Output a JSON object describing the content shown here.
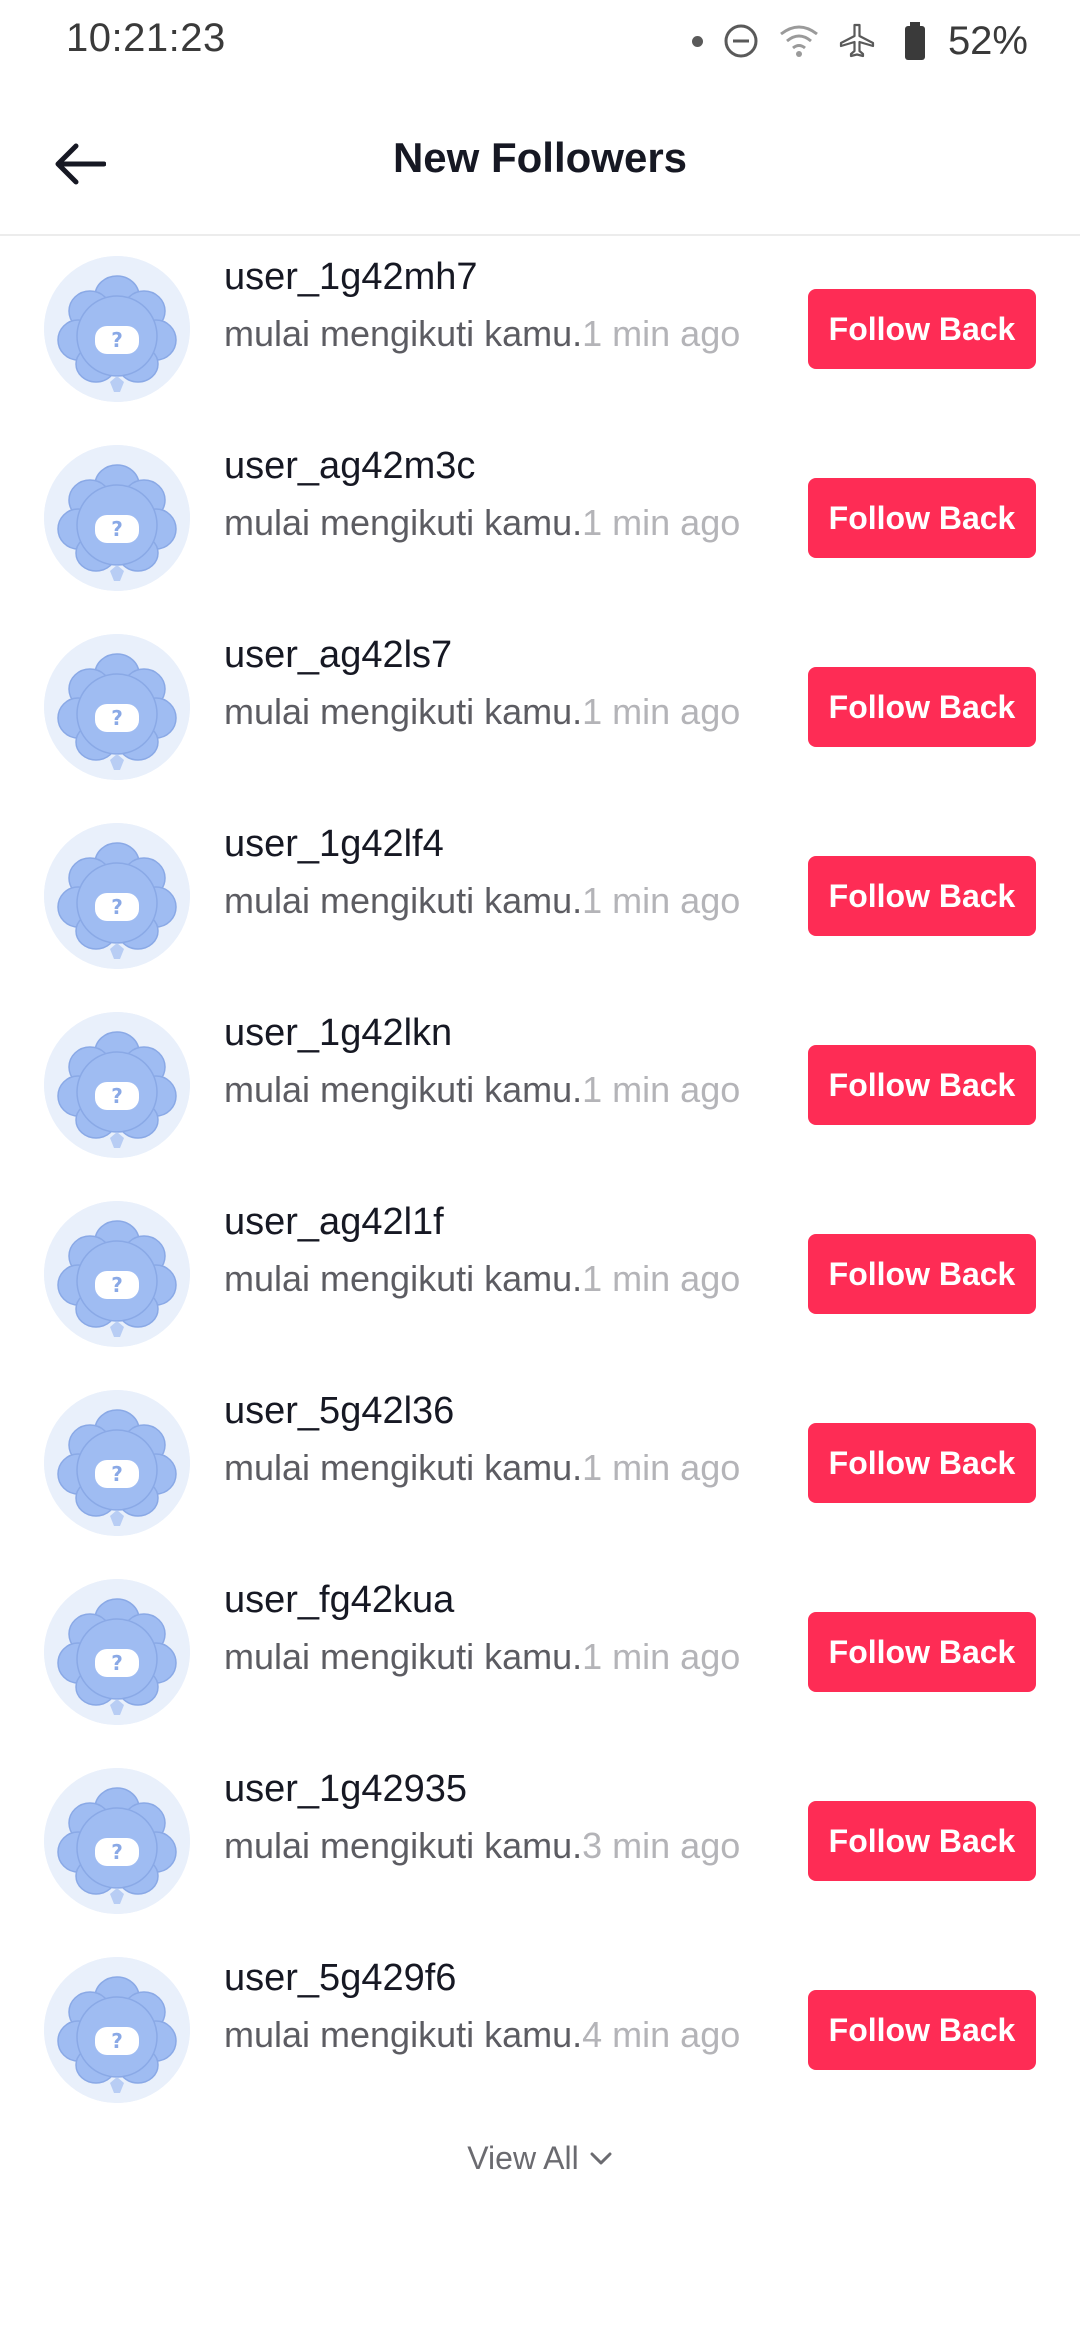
{
  "status_bar": {
    "time": "10:21:23",
    "battery_percent": "52%",
    "icons": [
      "notification-dot-icon",
      "do-not-disturb-icon",
      "wifi-icon",
      "airplane-mode-icon",
      "battery-icon"
    ]
  },
  "header": {
    "title": "New Followers",
    "back_icon": "arrow-left-icon"
  },
  "colors": {
    "accent": "#fe2c55",
    "text_primary": "#161823",
    "text_secondary": "#5c5c62",
    "text_muted": "#b4b4b8"
  },
  "followers": [
    {
      "username": "user_1g42mh7",
      "action": "mulai mengikuti kamu.",
      "time": "1 min ago",
      "button": "Follow Back"
    },
    {
      "username": "user_ag42m3c",
      "action": "mulai mengikuti kamu.",
      "time": "1 min ago",
      "button": "Follow Back"
    },
    {
      "username": "user_ag42ls7",
      "action": "mulai mengikuti kamu.",
      "time": "1 min ago",
      "button": "Follow Back"
    },
    {
      "username": "user_1g42lf4",
      "action": "mulai mengikuti kamu.",
      "time": "1 min ago",
      "button": "Follow Back"
    },
    {
      "username": "user_1g42lkn",
      "action": "mulai mengikuti kamu.",
      "time": "1 min ago",
      "button": "Follow Back"
    },
    {
      "username": "user_ag42l1f",
      "action": "mulai mengikuti kamu.",
      "time": "1 min ago",
      "button": "Follow Back"
    },
    {
      "username": "user_5g42l36",
      "action": "mulai mengikuti kamu.",
      "time": "1 min ago",
      "button": "Follow Back"
    },
    {
      "username": "user_fg42kua",
      "action": "mulai mengikuti kamu.",
      "time": "1 min ago",
      "button": "Follow Back"
    },
    {
      "username": "user_1g42935",
      "action": "mulai mengikuti kamu.",
      "time": "3 min ago",
      "button": "Follow Back"
    },
    {
      "username": "user_5g429f6",
      "action": "mulai mengikuti kamu.",
      "time": "4 min ago",
      "button": "Follow Back"
    }
  ],
  "view_all": {
    "label": "View All",
    "icon": "chevron-down-icon"
  }
}
